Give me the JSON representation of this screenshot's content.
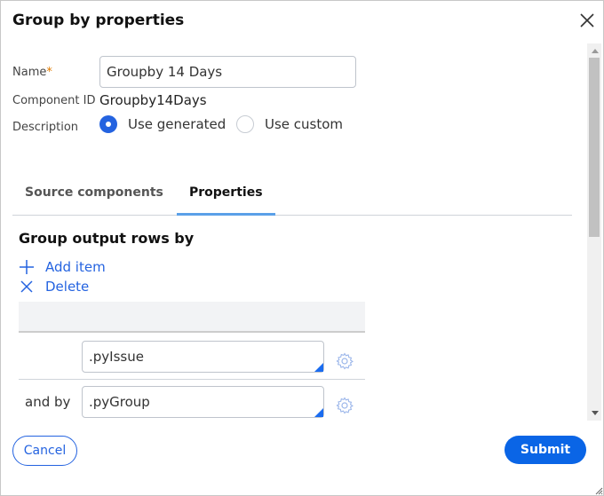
{
  "dialog": {
    "title": "Group by properties"
  },
  "form": {
    "name_label": "Name",
    "required_mark": "*",
    "name_value": "Groupby 14 Days",
    "component_id_label": "Component ID",
    "component_id_value": "Groupby14Days",
    "description_label": "Description",
    "description_options": [
      {
        "label": "Use generated",
        "selected": true
      },
      {
        "label": "Use custom",
        "selected": false
      }
    ]
  },
  "tabs": [
    {
      "label": "Source components",
      "active": false
    },
    {
      "label": "Properties",
      "active": true
    }
  ],
  "properties": {
    "heading": "Group output rows by",
    "add_label": "Add item",
    "delete_label": "Delete",
    "rows": [
      {
        "prefix": "",
        "value": ".pyIssue"
      },
      {
        "prefix": "and by",
        "value": ".pyGroup"
      }
    ]
  },
  "footer": {
    "cancel": "Cancel",
    "submit": "Submit"
  },
  "colors": {
    "accent": "#0a65e6",
    "tab_underline": "#5aa0e8"
  }
}
